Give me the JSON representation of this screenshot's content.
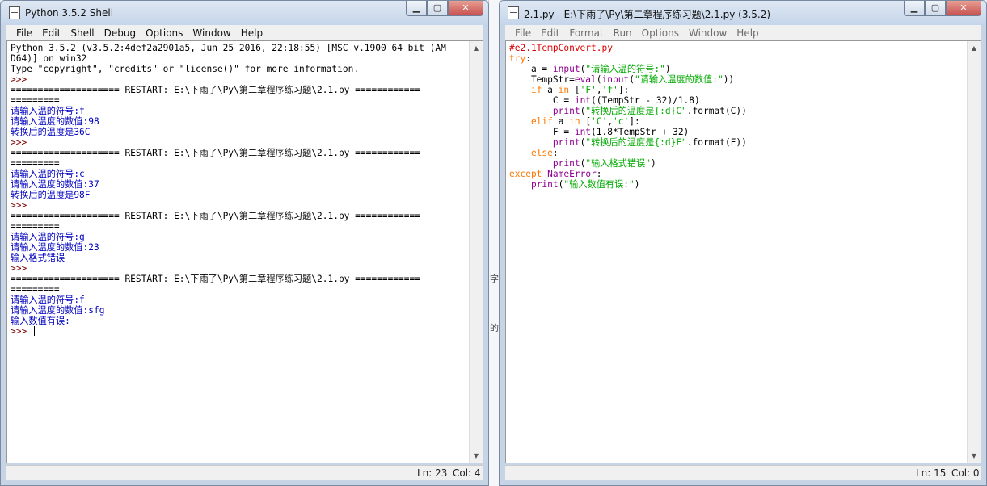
{
  "shell": {
    "title": "Python 3.5.2 Shell",
    "menu": [
      "File",
      "Edit",
      "Shell",
      "Debug",
      "Options",
      "Window",
      "Help"
    ],
    "status_ln": "Ln: 23",
    "status_col": "Col: 4",
    "lines": [
      {
        "t": "Python 3.5.2 (v3.5.2:4def2a2901a5, Jun 25 2016, 22:18:55) [MSC v.1900 64 bit (AM",
        "c": ""
      },
      {
        "t": "D64)] on win32",
        "c": ""
      },
      {
        "t": "Type \"copyright\", \"credits\" or \"license()\" for more information.",
        "c": ""
      },
      {
        "t": ">>> ",
        "c": "prompt"
      },
      {
        "t": "==================== RESTART: E:\\下雨了\\Py\\第二章程序练习题\\2.1.py ============",
        "c": ""
      },
      {
        "t": "=========",
        "c": ""
      },
      {
        "t": "请输入温的符号:f",
        "c": "out"
      },
      {
        "t": "请输入温度的数值:98",
        "c": "out"
      },
      {
        "t": "转换后的温度是36C",
        "c": "out"
      },
      {
        "t": ">>> ",
        "c": "prompt"
      },
      {
        "t": "==================== RESTART: E:\\下雨了\\Py\\第二章程序练习题\\2.1.py ============",
        "c": ""
      },
      {
        "t": "=========",
        "c": ""
      },
      {
        "t": "请输入温的符号:c",
        "c": "out"
      },
      {
        "t": "请输入温度的数值:37",
        "c": "out"
      },
      {
        "t": "转换后的温度是98F",
        "c": "out"
      },
      {
        "t": ">>> ",
        "c": "prompt"
      },
      {
        "t": "==================== RESTART: E:\\下雨了\\Py\\第二章程序练习题\\2.1.py ============",
        "c": ""
      },
      {
        "t": "=========",
        "c": ""
      },
      {
        "t": "请输入温的符号:g",
        "c": "out"
      },
      {
        "t": "请输入温度的数值:23",
        "c": "out"
      },
      {
        "t": "输入格式错误",
        "c": "out"
      },
      {
        "t": ">>> ",
        "c": "prompt"
      },
      {
        "t": "==================== RESTART: E:\\下雨了\\Py\\第二章程序练习题\\2.1.py ============",
        "c": ""
      },
      {
        "t": "=========",
        "c": ""
      },
      {
        "t": "请输入温的符号:f",
        "c": "out"
      },
      {
        "t": "请输入温度的数值:sfg",
        "c": "out"
      },
      {
        "t": "输入数值有误:",
        "c": "out"
      },
      {
        "t": ">>> ",
        "c": "prompt",
        "cursor": true
      }
    ]
  },
  "editor": {
    "title": "2.1.py - E:\\下雨了\\Py\\第二章程序练习题\\2.1.py (3.5.2)",
    "menu": [
      "File",
      "Edit",
      "Format",
      "Run",
      "Options",
      "Window",
      "Help"
    ],
    "status_ln": "Ln: 15",
    "status_col": "Col: 0",
    "lines": [
      [
        [
          "#e2.1TempConvert.py",
          "cmt"
        ]
      ],
      [
        [
          "try",
          "kw"
        ],
        [
          ":",
          ""
        ]
      ],
      [
        [
          "    a = ",
          ""
        ],
        [
          "input",
          "bi"
        ],
        [
          "(",
          ""
        ],
        [
          "\"请输入温的符号:\"",
          "str"
        ],
        [
          ")",
          ""
        ]
      ],
      [
        [
          "    TempStr=",
          ""
        ],
        [
          "eval",
          "bi"
        ],
        [
          "(",
          ""
        ],
        [
          "input",
          "bi"
        ],
        [
          "(",
          ""
        ],
        [
          "\"请输入温度的数值:\"",
          "str"
        ],
        [
          "))",
          ""
        ]
      ],
      [
        [
          "    ",
          ""
        ],
        [
          "if",
          "kw"
        ],
        [
          " a ",
          ""
        ],
        [
          "in",
          "kw"
        ],
        [
          " [",
          ""
        ],
        [
          "'F'",
          "str"
        ],
        [
          ",",
          ""
        ],
        [
          "'f'",
          "str"
        ],
        [
          "]:",
          ""
        ]
      ],
      [
        [
          "        C = ",
          ""
        ],
        [
          "int",
          "bi"
        ],
        [
          "((TempStr - 32)/1.8)",
          ""
        ]
      ],
      [
        [
          "        ",
          ""
        ],
        [
          "print",
          "bi"
        ],
        [
          "(",
          ""
        ],
        [
          "\"转换后的温度是{:d}C\"",
          "str"
        ],
        [
          ".format(C))",
          ""
        ]
      ],
      [
        [
          "    ",
          ""
        ],
        [
          "elif",
          "kw"
        ],
        [
          " a ",
          ""
        ],
        [
          "in",
          "kw"
        ],
        [
          " [",
          ""
        ],
        [
          "'C'",
          "str"
        ],
        [
          ",",
          ""
        ],
        [
          "'c'",
          "str"
        ],
        [
          "]:",
          ""
        ]
      ],
      [
        [
          "        F = ",
          ""
        ],
        [
          "int",
          "bi"
        ],
        [
          "(1.8*TempStr + 32)",
          ""
        ]
      ],
      [
        [
          "        ",
          ""
        ],
        [
          "print",
          "bi"
        ],
        [
          "(",
          ""
        ],
        [
          "\"转换后的温度是{:d}F\"",
          "str"
        ],
        [
          ".format(F))",
          ""
        ]
      ],
      [
        [
          "    ",
          ""
        ],
        [
          "else",
          "kw"
        ],
        [
          ":",
          ""
        ]
      ],
      [
        [
          "        ",
          ""
        ],
        [
          "print",
          "bi"
        ],
        [
          "(",
          ""
        ],
        [
          "\"输入格式错误\"",
          "str"
        ],
        [
          ")",
          ""
        ]
      ],
      [
        [
          "except",
          "kw"
        ],
        [
          " ",
          ""
        ],
        [
          "NameError",
          "bi"
        ],
        [
          ":",
          ""
        ]
      ],
      [
        [
          "    ",
          ""
        ],
        [
          "print",
          "bi"
        ],
        [
          "(",
          ""
        ],
        [
          "\"输入数值有误:\"",
          "str"
        ],
        [
          ")",
          ""
        ]
      ]
    ]
  },
  "background": {
    "glyph_a": "字",
    "glyph_b": "的"
  }
}
